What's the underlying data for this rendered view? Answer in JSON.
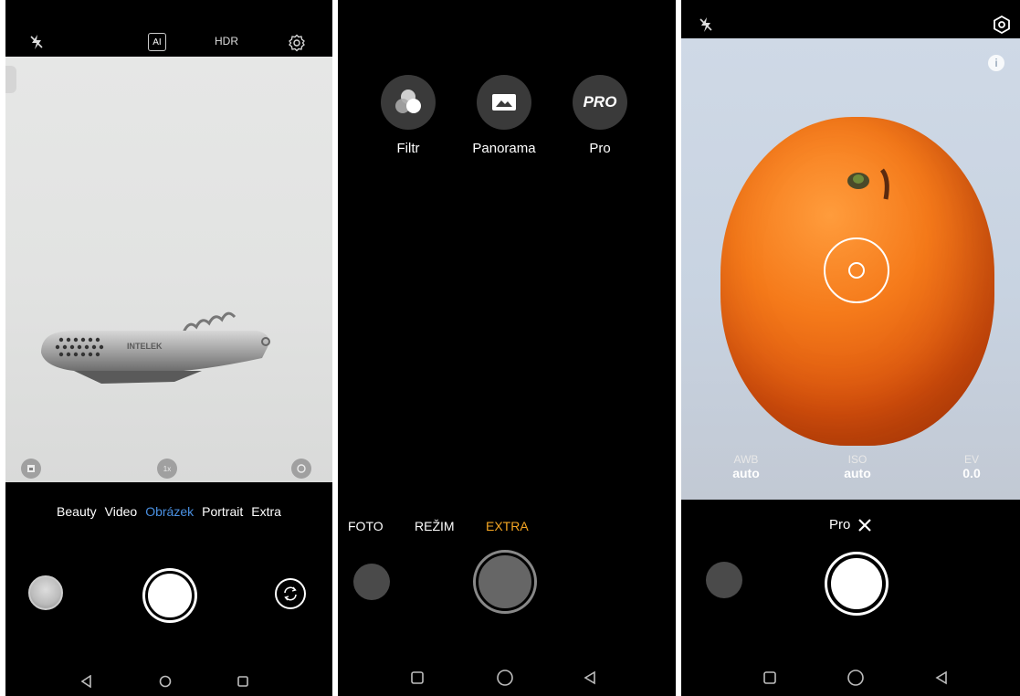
{
  "screen1": {
    "topbar": {
      "flash_icon": "flash-off-icon",
      "ai_label": "AI",
      "hdr_label": "HDR",
      "settings_icon": "gear-icon"
    },
    "viewfinder": {
      "brand_text": "INTELEK",
      "zoom_label": "1x"
    },
    "modes": [
      {
        "label": "Beauty",
        "active": false
      },
      {
        "label": "Video",
        "active": false
      },
      {
        "label": "Obrázek",
        "active": true
      },
      {
        "label": "Portrait",
        "active": false
      },
      {
        "label": "Extra",
        "active": false
      }
    ],
    "accent_color": "#4a90e2"
  },
  "screen2": {
    "modes": [
      {
        "label": "Filtr",
        "icon": "filter-icon"
      },
      {
        "label": "Panorama",
        "icon": "panorama-icon"
      },
      {
        "label": "Pro",
        "icon_text": "PRO"
      }
    ],
    "tabs": {
      "foto": "FOTO",
      "rezim": "REŽIM",
      "extra": "EXTRA"
    },
    "accent_color": "#f5a623"
  },
  "screen3": {
    "topbar": {
      "flash_icon": "flash-off-icon",
      "settings_icon": "settings-icon"
    },
    "params": [
      {
        "label": "AWB",
        "value": "auto"
      },
      {
        "label": "ISO",
        "value": "auto"
      },
      {
        "label": "EV",
        "value": "0.0"
      }
    ],
    "mode_label": "Pro",
    "close_icon": "close-icon"
  },
  "navbar": {
    "back_icon": "back-triangle-icon",
    "home_icon": "home-circle-icon",
    "recents_icon": "recents-square-icon"
  }
}
